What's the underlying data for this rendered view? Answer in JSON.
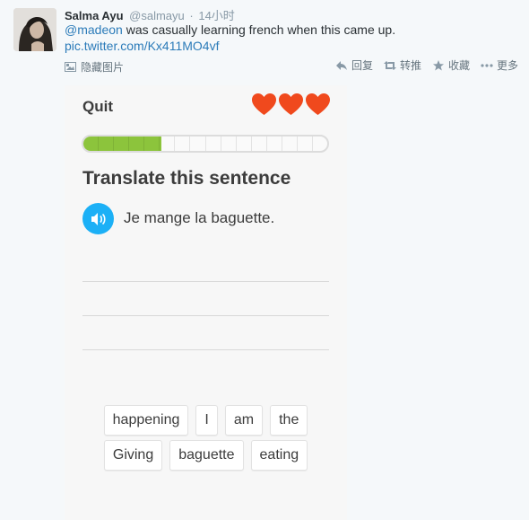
{
  "tweet": {
    "author_name": "Salma Ayu",
    "author_handle": "@salmayu",
    "separator": "·",
    "timestamp": "14小时",
    "mention": "@madeon",
    "text": " was casually learning french when this came up.",
    "pic_link": "pic.twitter.com/Kx411MO4vf",
    "hide_image": "隐藏图片",
    "actions": {
      "reply": "回复",
      "retweet": "转推",
      "favorite": "收藏",
      "more": "更多"
    }
  },
  "duolingo": {
    "quit_label": "Quit",
    "hearts": 3,
    "progress": 0.32,
    "progress_segments": 16,
    "instruction": "Translate this sentence",
    "sentence": "Je mange la baguette.",
    "word_bank_row1": [
      "happening",
      "I",
      "am",
      "the"
    ],
    "word_bank_row2": [
      "Giving",
      "baguette",
      "eating"
    ],
    "colors": {
      "heart": "#f0491d",
      "progress": "#8cc43c",
      "speaker": "#1cb0f6"
    }
  }
}
